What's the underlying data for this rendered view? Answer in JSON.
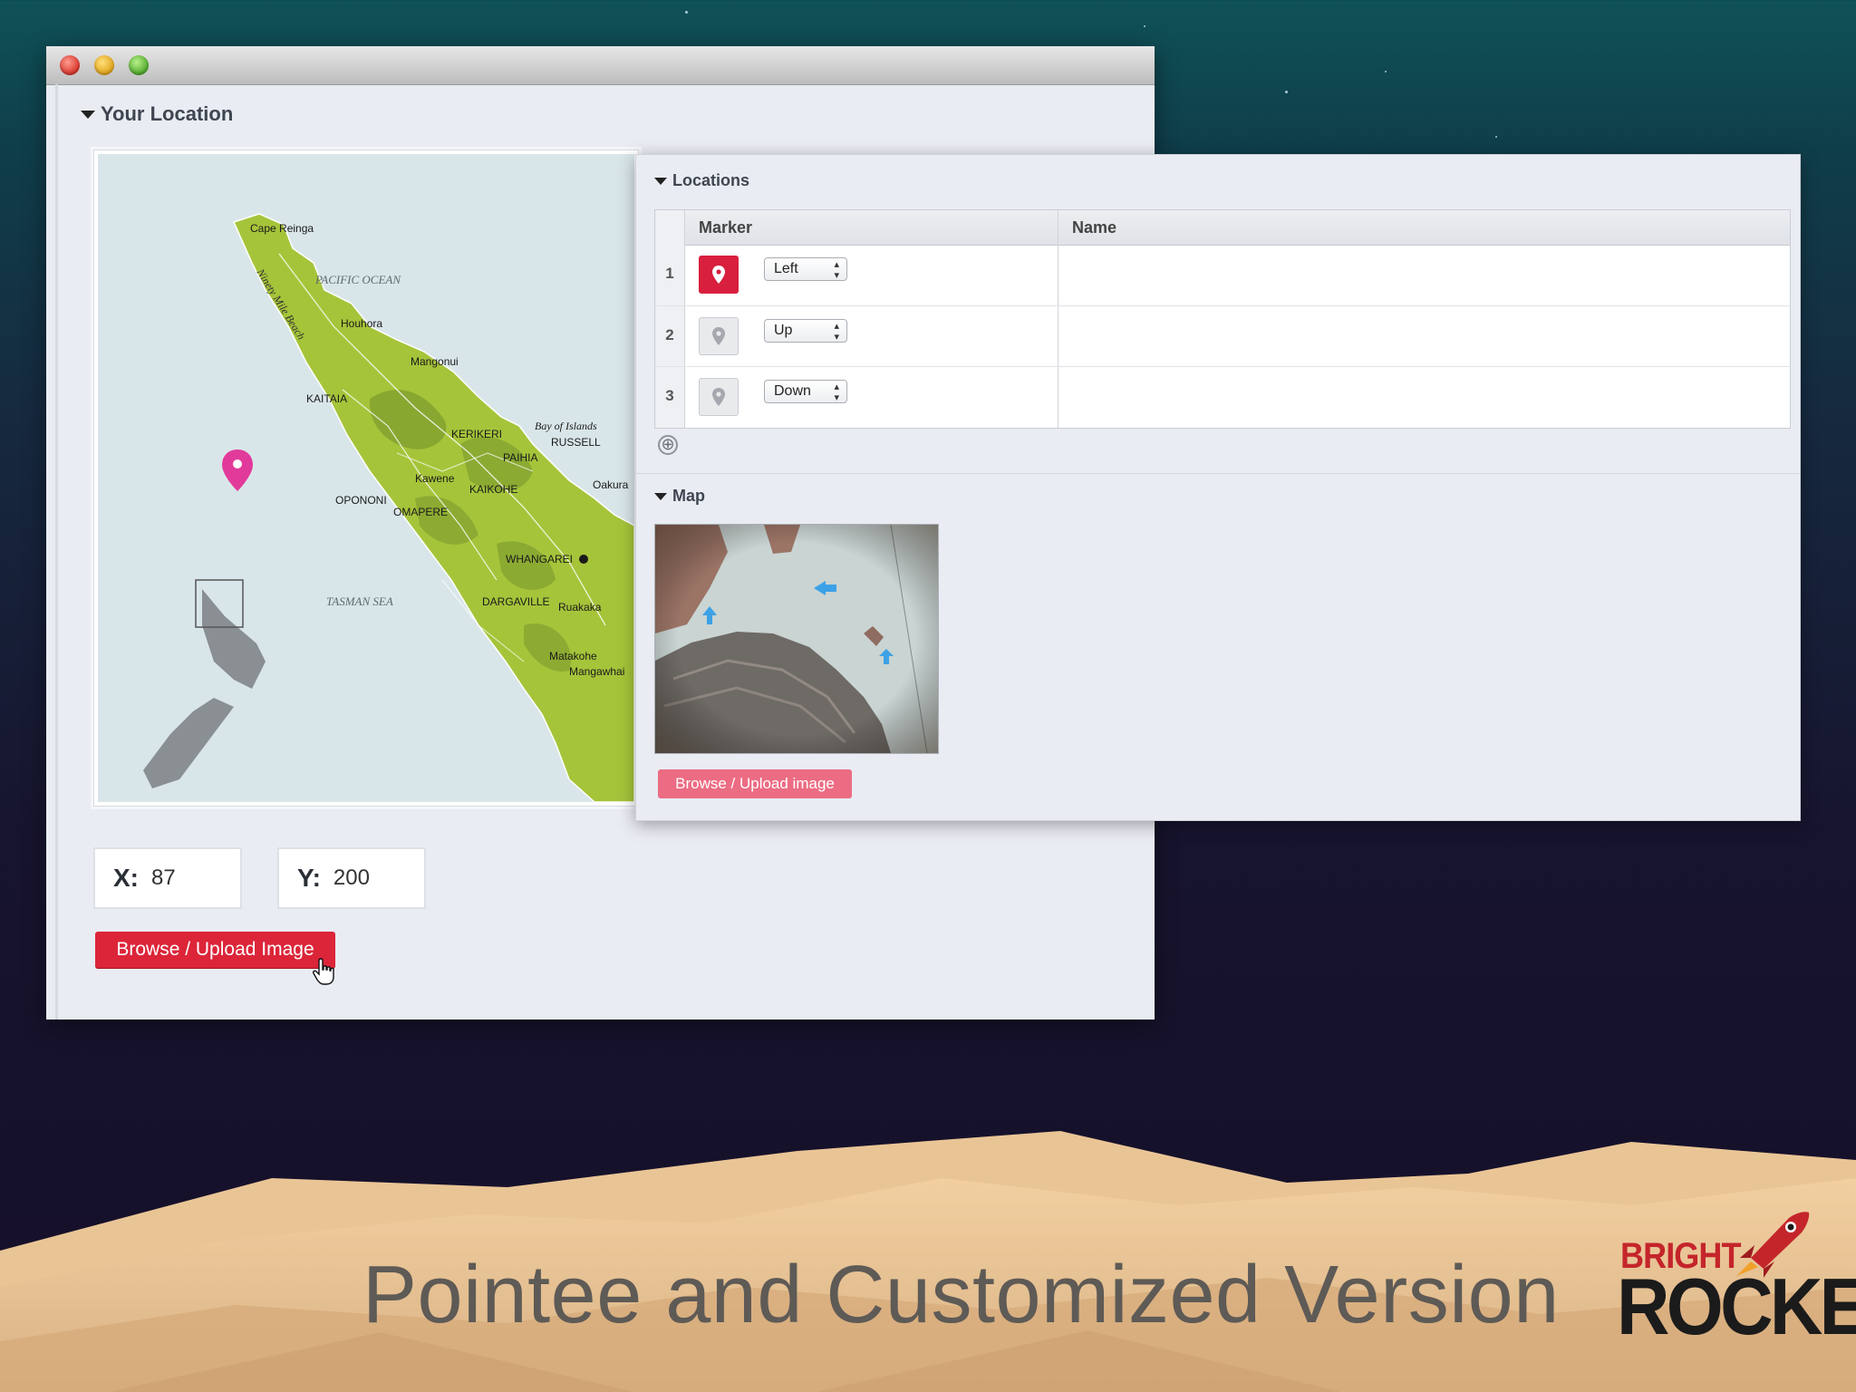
{
  "window": {
    "your_location": {
      "section_title": "Your Location",
      "map_labels": {
        "cape": "Cape Reinga",
        "ninety_mile": "Ninety Mile Beach",
        "pacific": "PACIFIC OCEAN",
        "houhora": "Houhora",
        "mangonui": "Mangonui",
        "kaitaia": "KAITAIA",
        "kerikeri": "KERIKERI",
        "bay": "Bay of Islands",
        "russell": "RUSSELL",
        "paihia": "PAIHIA",
        "kawene": "Kawene",
        "kaikohe": "KAIKOHE",
        "oakura": "Oakura",
        "opononi": "OPONONI",
        "omapere": "OMAPERE",
        "whangarei": "WHANGAREI",
        "tasman": "TASMAN SEA",
        "dargaville": "DARGAVILLE",
        "ruakaka": "Ruakaka",
        "matakohe": "Matakohe",
        "mangawhai": "Mangawhai"
      },
      "x_label": "X:",
      "x_value": "87",
      "y_label": "Y:",
      "y_value": "200",
      "browse_button": "Browse / Upload Image"
    }
  },
  "overlay": {
    "locations_title": "Locations",
    "columns": [
      "Marker",
      "Name"
    ],
    "rows": [
      {
        "index": "1",
        "direction": "Left",
        "name": "",
        "marker_state": "active"
      },
      {
        "index": "2",
        "direction": "Up",
        "name": "",
        "marker_state": "inactive"
      },
      {
        "index": "3",
        "direction": "Down",
        "name": "",
        "marker_state": "inactive"
      }
    ],
    "add_icon": "⊕",
    "map_title": "Map",
    "browse_button": "Browse / Upload image"
  },
  "slide": {
    "title": "Pointee and Customized Version",
    "logo_top": "BRIGHT",
    "logo_bottom": "ROCKET"
  },
  "colors": {
    "accent_red": "#dc2539",
    "marker_pink": "#e23a9b",
    "land_green": "#a6c43a"
  },
  "icons": [
    "map-pin-icon",
    "add-circle-icon",
    "chevron-updown-icon",
    "hand-cursor-icon",
    "rocket-icon",
    "disclosure-triangle-icon"
  ]
}
